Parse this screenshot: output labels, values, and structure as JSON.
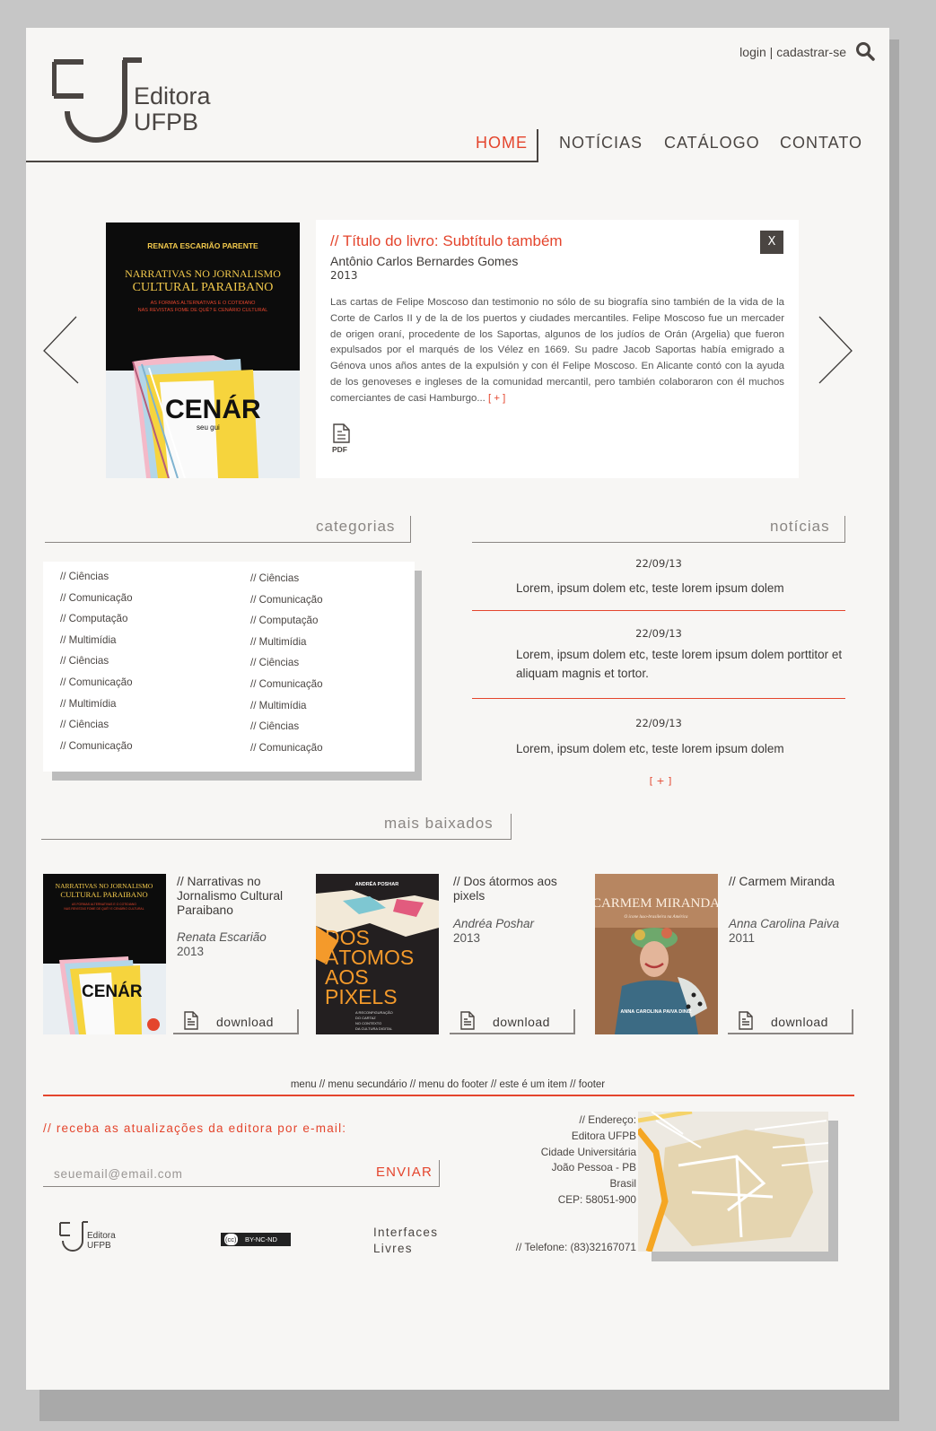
{
  "header": {
    "brand_line1": "Editora",
    "brand_line2": "UFPB",
    "login": "login",
    "separator": "|",
    "signup": "cadastrar-se",
    "nav": [
      "HOME",
      "NOTÍCIAS",
      "CATÁLOGO",
      "CONTATO"
    ],
    "active_nav": "HOME"
  },
  "featured": {
    "title": "// Título do livro: Subtítulo também",
    "author": "Antônio Carlos Bernardes Gomes",
    "year": "2013",
    "description": "Las cartas de Felipe Moscoso dan testimonio no sólo de su biografía sino también de la vida de la Corte de Carlos II y de la de los puertos y ciudades mercantiles. Felipe Moscoso fue un mercader de origen oraní, procedente de los Saportas, algunos de los judíos de Orán (Argelia) que fueron expulsados por el marqués de los Vélez en 1669. Su padre Jacob Saportas había emigrado a Génova unos años antes de la expulsión y con él Felipe Moscoso. En Alicante contó con la ayuda de los genoveses e ingleses de la comunidad mercantil, pero también colaboraron con él muchos comerciantes de casi Hamburgo...",
    "more": "[ + ]",
    "close": "X",
    "pdf_label": "PDF",
    "cover": {
      "author": "RENATA ESCARIÃO PARENTE",
      "title1": "NARRATIVAS NO JORNALISMO",
      "title2": "CULTURAL PARAIBANO",
      "subtitle1": "AS FORMAS ALTERNATIVAS E O COTIDIANO",
      "subtitle2": "NAS REVISTAS FOME DE QUÊ? E CENÁRIO CULTURAL",
      "magazine": "CENÁR",
      "magazine_sub": "seu gui"
    }
  },
  "categories": {
    "heading": "categorias",
    "col1": [
      "// Ciências",
      "// Comunicação",
      "// Computação",
      "// Multimídia",
      "// Ciências",
      "// Comunicação",
      "// Multimídia",
      "// Ciências",
      "// Comunicação"
    ],
    "col2": [
      "// Ciências",
      "// Comunicação",
      "// Computação",
      "// Multimídia",
      "// Ciências",
      "// Comunicação",
      "// Multimídia",
      "// Ciências",
      "// Comunicação"
    ]
  },
  "news": {
    "heading": "notícias",
    "items": [
      {
        "date": "22/09/13",
        "text": "Lorem, ipsum dolem etc, teste lorem ipsum dolem"
      },
      {
        "date": "22/09/13",
        "text": "Lorem, ipsum dolem etc, teste lorem ipsum dolem porttitor et aliquam magnis et tortor."
      },
      {
        "date": "22/09/13",
        "text": "Lorem, ipsum dolem etc, teste lorem ipsum dolem"
      }
    ],
    "more": "[ + ]"
  },
  "most_downloaded": {
    "heading": "mais baixados",
    "download_label": "download",
    "books": [
      {
        "title": "// Narrativas no Jornalismo Cultural Paraibano",
        "author": "Renata Escarião",
        "year": "2013"
      },
      {
        "title": "// Dos átormos aos pixels",
        "author": "Andréa Poshar",
        "year": "2013",
        "cover": {
          "author": "ANDRÉA POSHAR",
          "title": [
            "DOS",
            "ÁTOMOS",
            "AOS",
            "PIXELS"
          ],
          "subtitle": [
            "A RECONFIGURAÇÃO",
            "DO CARTAZ",
            "NO CONTEXTO",
            "DA CULTURA DIGITAL"
          ]
        }
      },
      {
        "title": "// Carmem Miranda",
        "author": "Anna Carolina Paiva",
        "year": "2011",
        "cover": {
          "title": "CARMEM MIRANDA",
          "subtitle": "O ícone luso-brasileira na América",
          "author": "ANNA CAROLINA PAIVA DINIZ"
        }
      }
    ]
  },
  "footer": {
    "menu": "menu // menu secundário // menu do footer // este é um item // footer",
    "newsletter_label": "// receba as atualizações da editora por e-mail:",
    "email_placeholder": "seuemail@email.com",
    "send": "ENVIAR",
    "address": [
      "// Endereço:",
      "Editora UFPB",
      "Cidade Universitária",
      "João Pessoa - PB",
      "Brasil",
      "CEP: 58051-900"
    ],
    "phone": "// Telefone: (83)32167071",
    "small_brand1": "Editora",
    "small_brand2": "UFPB",
    "license": [
      "(cc)",
      "BY-NC-ND"
    ],
    "interfaces": [
      "Interfaces",
      "Livres"
    ]
  },
  "colors": {
    "accent": "#e4452d",
    "text": "#4a4542",
    "page": "#f7f6f4",
    "background": "#c6c6c6"
  },
  "icons": [
    "search-icon",
    "close-icon",
    "pdf-icon",
    "prev-arrow-icon",
    "next-arrow-icon",
    "download-file-icon"
  ]
}
